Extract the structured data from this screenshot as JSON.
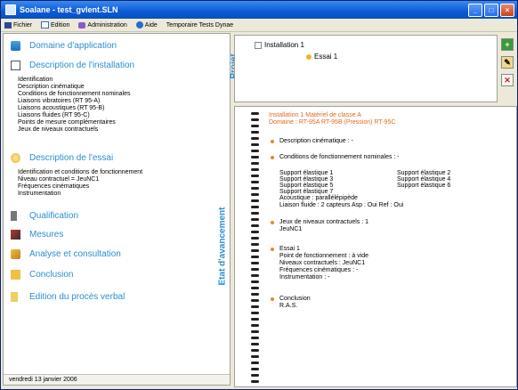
{
  "window": {
    "title": "Soalane - test_gvlent.SLN"
  },
  "menu": {
    "fichier": "Fichier",
    "edition": "Edition",
    "administration": "Administration",
    "aide": "Aide",
    "template": "Temporaire Tests Dynae"
  },
  "sidebar": {
    "domaine": "Domaine d'application",
    "description_installation": "Description de l'installation",
    "install_items": [
      "Identification",
      "Description cinématique",
      "Conditions de fonctionnement nominales",
      "Liaisons vibratoires (RT 95-A)",
      "Liaisons acoustiques (RT 95-B)",
      "Liaisons fluides (RT 95-C)",
      "Points de mesure complémentaires",
      "Jeux de niveaux contractuels"
    ],
    "description_essai": "Description de l'essai",
    "essai_items": [
      "Identification et conditions de fonctionnement",
      "Niveau contractuel = JeuNC1",
      "Fréquences cinématiques",
      "Instrumentation"
    ],
    "qualification": "Qualification",
    "mesures": "Mesures",
    "analyse": "Analyse et consultation",
    "conclusion": "Conclusion",
    "edition": "Edition du procès verbal"
  },
  "statusbar": {
    "date": "vendredi 13 janvier 2006"
  },
  "projet": {
    "tab": "Projet",
    "installation": "Installation 1",
    "essai": "Essai 1"
  },
  "etat": {
    "tab": "Etat d'avancement",
    "header1": "Installation 1    Matériel de classe A",
    "header2": "Domaine : RT-95A RT-95B (Pression) RT-95C",
    "desc_cine": "Description cinématique : -",
    "cond_nom": "Conditions de fonctionnement nominales : -",
    "supports_left": [
      "Support élastique 1",
      "Support élastique 3",
      "Support élastique 5",
      "Support élastique 7"
    ],
    "supports_right": [
      "Support élastique 2",
      "Support élastique 4",
      "Support élastique 6"
    ],
    "acoustique": "Acoustique : parallélépipède",
    "liaison_fluide": "Liaison fluide : 2 capteurs   Asp : Oui  Ref : Oui",
    "jeux": "Jeux de niveaux contractuels : 1",
    "jeunc": "JeuNC1",
    "essai_title": "Essai 1",
    "essai_lines": [
      "Point de fonctionnement : à vide",
      "Niveaux contractuels : JeuNC1",
      "Fréquences cinématiques : -",
      "Instrumentation : -"
    ],
    "conclusion": "Conclusion",
    "ras": "R.A.S."
  },
  "colors": {
    "accent": "#2a8fd0",
    "orange": "#e06a20"
  }
}
